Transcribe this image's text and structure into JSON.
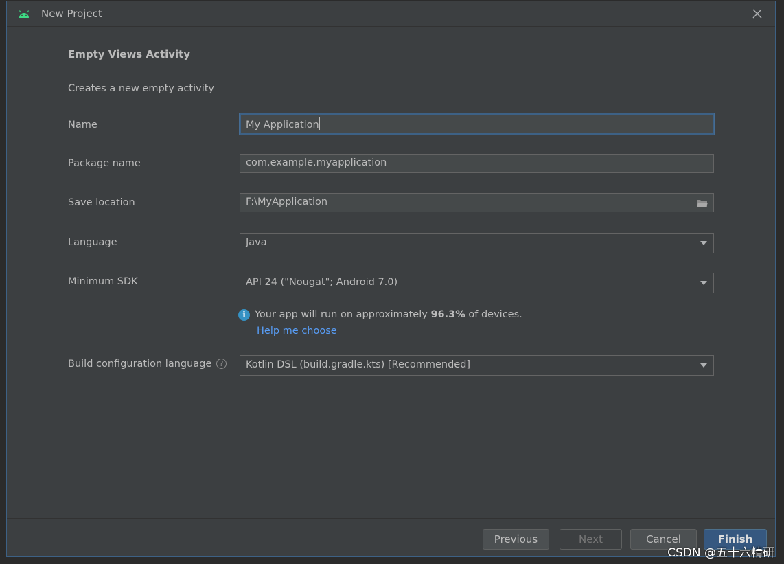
{
  "window": {
    "title": "New Project",
    "close_icon": "close-icon"
  },
  "template": {
    "heading": "Empty Views Activity",
    "description": "Creates a new empty activity"
  },
  "form": {
    "name": {
      "label": "Name",
      "value": "My Application"
    },
    "package": {
      "label": "Package name",
      "value": "com.example.myapplication"
    },
    "save_location": {
      "label": "Save location",
      "value": "F:\\MyApplication",
      "icon": "folder-icon"
    },
    "language": {
      "label": "Language",
      "value": "Java"
    },
    "min_sdk": {
      "label": "Minimum SDK",
      "value": "API 24 (\"Nougat\"; Android 7.0)"
    },
    "build_config": {
      "label": "Build configuration language",
      "value": "Kotlin DSL (build.gradle.kts) [Recommended]",
      "help_glyph": "?"
    }
  },
  "info": {
    "icon_glyph": "i",
    "prefix": "Your app will run on approximately ",
    "percent": "96.3%",
    "suffix": " of devices.",
    "help_link": "Help me choose"
  },
  "buttons": {
    "previous": "Previous",
    "next": "Next",
    "cancel": "Cancel",
    "finish": "Finish"
  },
  "watermark": "CSDN @五十六精研",
  "colors": {
    "accent": "#365880",
    "link": "#589df6",
    "info": "#3592c4",
    "android": "#3ddc84"
  }
}
